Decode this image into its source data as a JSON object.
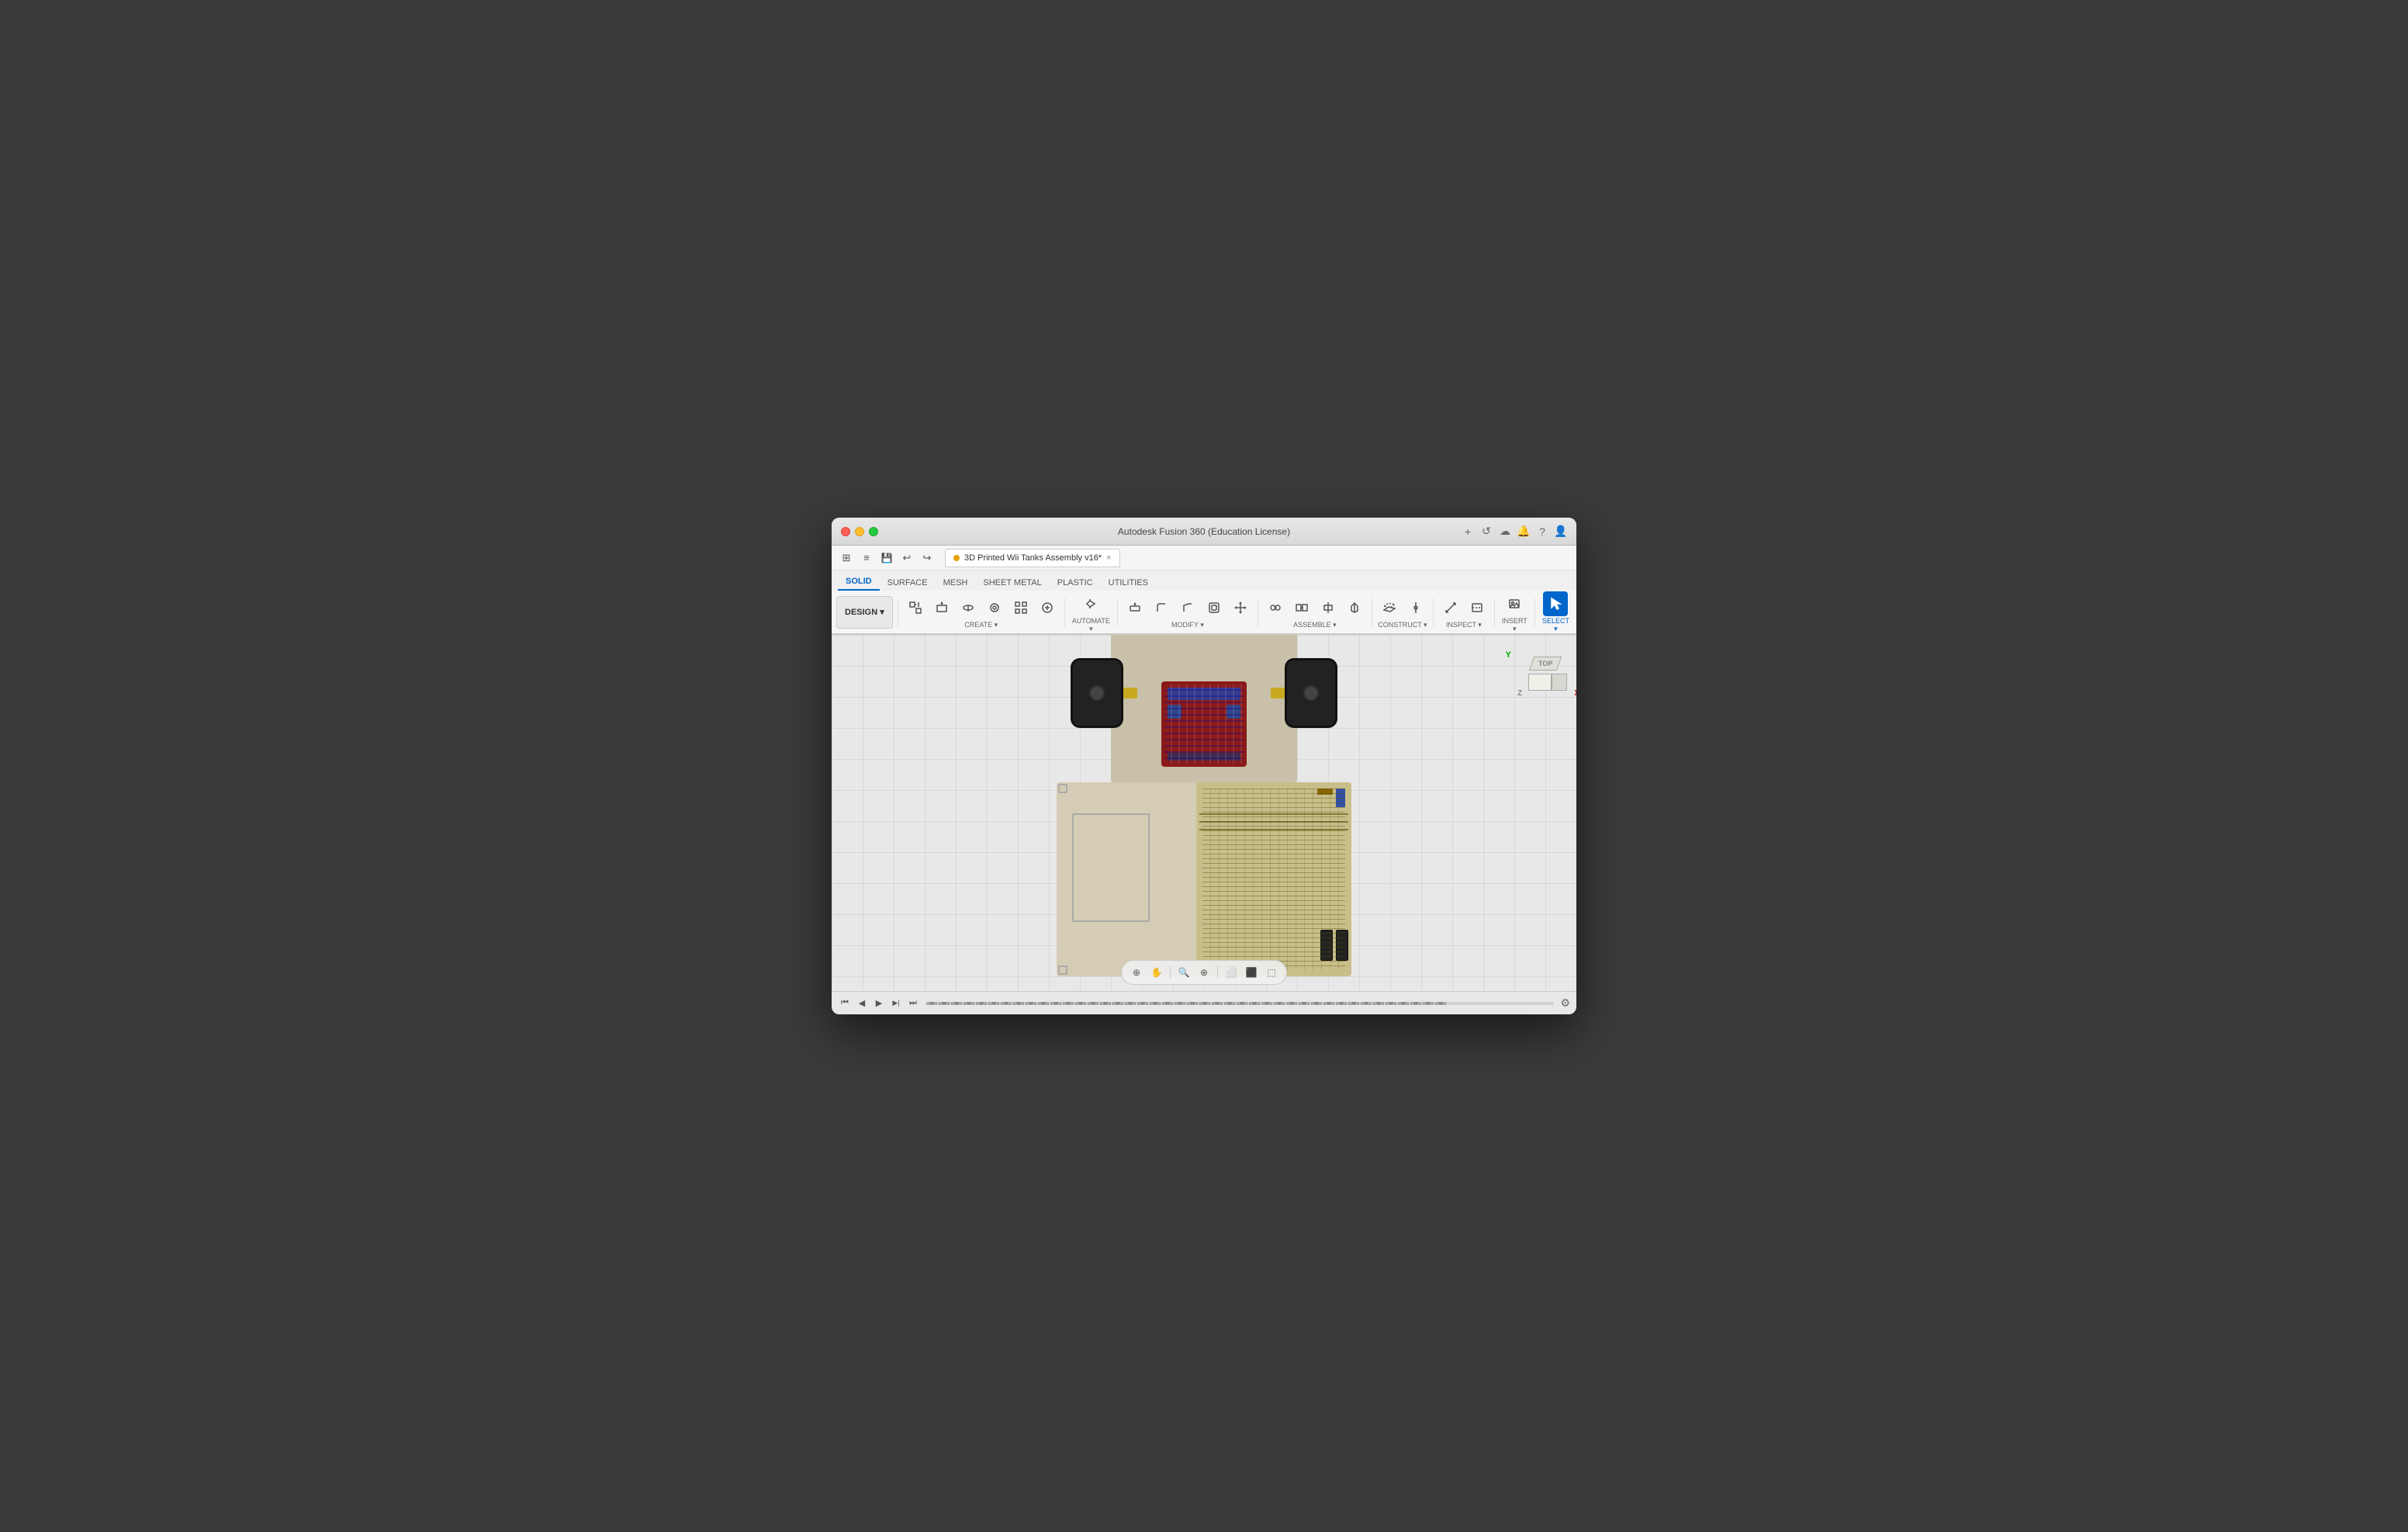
{
  "window": {
    "title": "Autodesk Fusion 360 (Education License)",
    "file_title": "3D Printed Wii Tanks Assembly v16*"
  },
  "titlebar": {
    "close": "×",
    "minimize": "–",
    "maximize": "+",
    "plus_icon": "+",
    "refresh_icon": "↺",
    "cloud_icon": "☁",
    "bell_icon": "🔔",
    "help_icon": "?",
    "profile_icon": "👤"
  },
  "toolbar_top": {
    "grid_icon": "⊞",
    "menu_icon": "≡",
    "save_icon": "💾",
    "undo_icon": "↩",
    "redo_icon": "↪"
  },
  "design_button": {
    "label": "DESIGN ▾"
  },
  "toolbar_tabs": [
    {
      "label": "SOLID",
      "active": true
    },
    {
      "label": "SURFACE",
      "active": false
    },
    {
      "label": "MESH",
      "active": false
    },
    {
      "label": "SHEET METAL",
      "active": false
    },
    {
      "label": "PLASTIC",
      "active": false
    },
    {
      "label": "UTILITIES",
      "active": false
    }
  ],
  "toolbar_groups": [
    {
      "label": "CREATE ▾"
    },
    {
      "label": "AUTOMATE ▾"
    },
    {
      "label": "MODIFY ▾"
    },
    {
      "label": "ASSEMBLE ▾"
    },
    {
      "label": "CONSTRUCT ▾"
    },
    {
      "label": "INSPECT ▾"
    },
    {
      "label": "INSERT ▾"
    },
    {
      "label": "SELECT ▾",
      "active": true
    }
  ],
  "nav_cube": {
    "top_label": "TOP",
    "y_axis": "Y",
    "z_axis": "Z",
    "x_axis": "X"
  },
  "viewport_bottom": {
    "fit_icon": "⊕",
    "pan_icon": "✋",
    "look_icon": "🔍",
    "zoom_icon": "⊕",
    "zoom_out_icon": "⊖",
    "view_icon": "⬜",
    "display_icon": "⬛",
    "effects_icon": "⬚"
  },
  "timeline": {
    "start_icon": "⏮",
    "prev_icon": "◀",
    "play_icon": "▶",
    "next_icon": "▶|",
    "end_icon": "⏭",
    "settings_icon": "⚙"
  }
}
